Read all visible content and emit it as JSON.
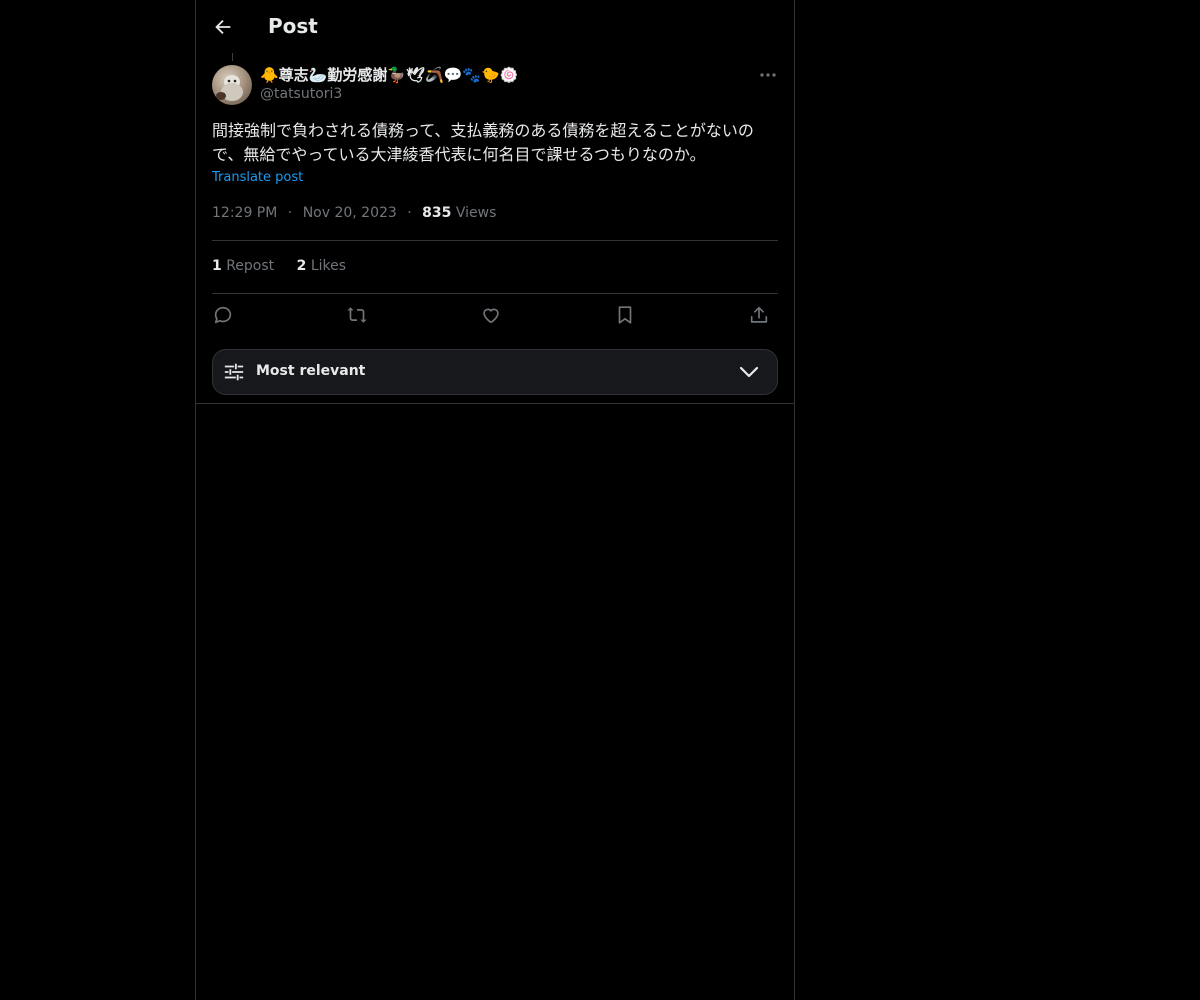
{
  "header": {
    "title": "Post"
  },
  "post": {
    "display_name": "🐥尊志🦢勤労感謝🦆🕊🪃💬🐾🐤🍥",
    "handle": "@tatsutori3",
    "text": "間接強制で負わされる債務って、支払義務のある債務を超えることがないので、無給でやっている大津綾香代表に何名目で課せるつもりなのか。",
    "translate_label": "Translate post",
    "time": "12:29 PM",
    "date": "Nov 20, 2023",
    "separator": "·",
    "views_count": "835",
    "views_label": "Views",
    "reposts_count": "1",
    "reposts_label": "Repost",
    "likes_count": "2",
    "likes_label": "Likes"
  },
  "sort": {
    "label": "Most relevant"
  },
  "colors": {
    "background": "#000000",
    "text": "#e7e9ea",
    "muted": "#71767b",
    "link": "#1d9bf0",
    "border": "#2f3336"
  },
  "icons": [
    "back-arrow-icon",
    "more-icon",
    "reply-icon",
    "repost-icon",
    "like-icon",
    "bookmark-icon",
    "share-icon",
    "sliders-icon",
    "chevron-down-icon"
  ]
}
